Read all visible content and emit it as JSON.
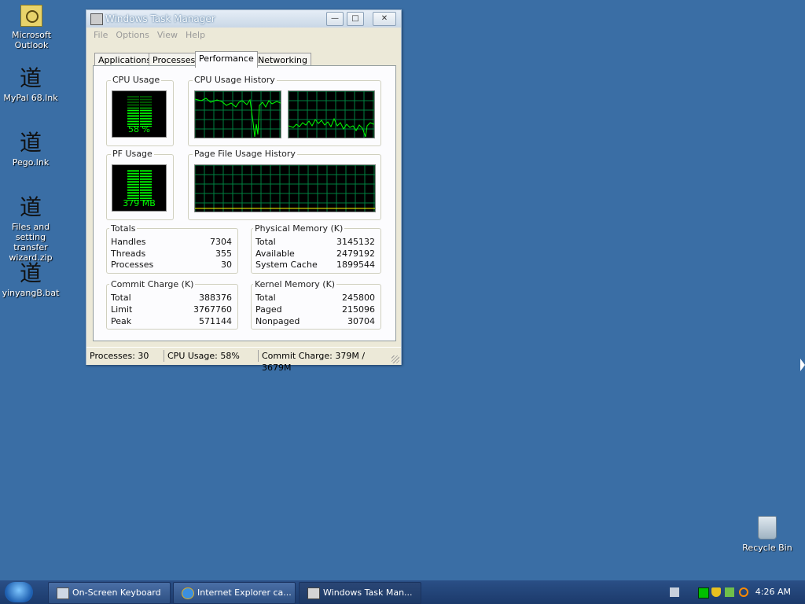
{
  "desktop": {
    "icons": [
      {
        "label": "Microsoft Outlook",
        "icon": "outlook-icon"
      },
      {
        "label": "MyPal 68.lnk",
        "icon": "dao-shortcut-icon"
      },
      {
        "label": "Pego.lnk",
        "icon": "dao-shortcut-icon"
      },
      {
        "label": "Files and setting transfer wizard.zip",
        "icon": "dao-shortcut-icon"
      },
      {
        "label": "yinyangB.bat",
        "icon": "dao-shortcut-icon"
      },
      {
        "label": "Recycle Bin",
        "icon": "recycle-bin-icon"
      }
    ],
    "glyph": "道",
    "background": "#3a6ea5"
  },
  "window": {
    "title": "Windows Task Manager",
    "menu": [
      "File",
      "Options",
      "View",
      "Help"
    ],
    "tabs": [
      "Applications",
      "Processes",
      "Performance",
      "Networking"
    ],
    "active_tab": "Performance",
    "performance": {
      "cpu_usage": {
        "title": "CPU Usage",
        "value": "58 %",
        "percent": 58
      },
      "cpu_history": {
        "title": "CPU Usage History"
      },
      "pf_usage": {
        "title": "PF Usage",
        "value": "379 MB"
      },
      "pf_history": {
        "title": "Page File Usage History"
      },
      "totals": {
        "title": "Totals",
        "rows": [
          {
            "label": "Handles",
            "value": "7304"
          },
          {
            "label": "Threads",
            "value": "355"
          },
          {
            "label": "Processes",
            "value": "30"
          }
        ]
      },
      "physical_memory": {
        "title": "Physical Memory (K)",
        "rows": [
          {
            "label": "Total",
            "value": "3145132"
          },
          {
            "label": "Available",
            "value": "2479192"
          },
          {
            "label": "System Cache",
            "value": "1899544"
          }
        ]
      },
      "commit_charge": {
        "title": "Commit Charge (K)",
        "rows": [
          {
            "label": "Total",
            "value": "388376"
          },
          {
            "label": "Limit",
            "value": "3767760"
          },
          {
            "label": "Peak",
            "value": "571144"
          }
        ]
      },
      "kernel_memory": {
        "title": "Kernel Memory (K)",
        "rows": [
          {
            "label": "Total",
            "value": "245800"
          },
          {
            "label": "Paged",
            "value": "215096"
          },
          {
            "label": "Nonpaged",
            "value": "30704"
          }
        ]
      }
    },
    "status": {
      "processes": "Processes: 30",
      "cpu": "CPU Usage: 58%",
      "commit": "Commit Charge: 379M / 3679M"
    }
  },
  "taskbar": {
    "buttons": [
      {
        "label": "On-Screen Keyboard",
        "icon": "keyboard-icon"
      },
      {
        "label": "Internet Explorer ca...",
        "icon": "internet-explorer-icon"
      },
      {
        "label": "Windows Task Man...",
        "icon": "task-manager-icon"
      }
    ],
    "clock": "4:26 AM"
  },
  "colors": {
    "graph_green": "#00ff00",
    "grid": "#008040",
    "title_bar": "#c9d7e6"
  }
}
